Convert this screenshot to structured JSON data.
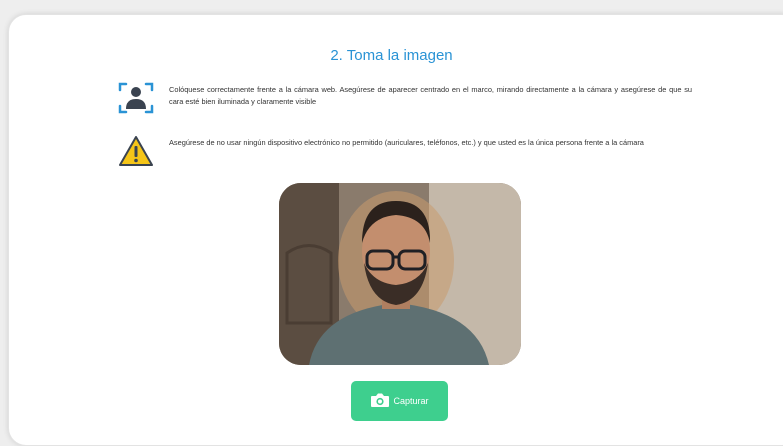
{
  "step_title": "2. Toma la imagen",
  "instructions": [
    {
      "icon": "face-scan-icon",
      "text": "Colóquese correctamente frente a la cámara web. Asegúrese de aparecer centrado en el marco, mirando directamente a la cámara y asegúrese de que su cara esté bien iluminada y claramente visible"
    },
    {
      "icon": "warning-icon",
      "text": "Asegúrese de no usar ningún dispositivo electrónico no permitido (auriculares, teléfonos, etc.) y que usted es la única persona frente a la cámara"
    }
  ],
  "capture_button": {
    "label": "Capturar",
    "icon": "camera-icon"
  },
  "colors": {
    "accent": "#2a93d5",
    "button": "#3ecf8e",
    "warning": "#f5c518",
    "icon_dark": "#3a4350"
  }
}
